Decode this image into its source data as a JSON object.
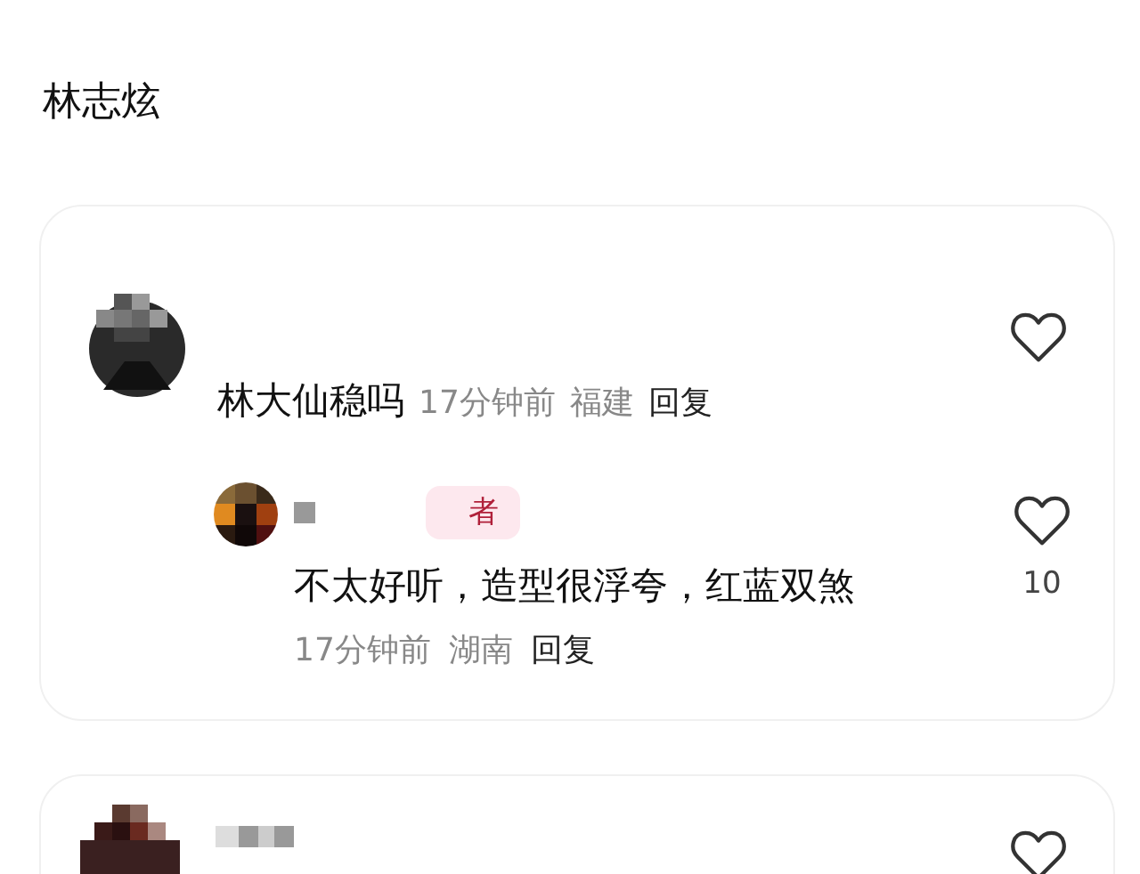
{
  "title": "林志炫",
  "comments": [
    {
      "kind": "full",
      "text": "林大仙稳吗",
      "time": "17分钟前",
      "location": "福建",
      "reply": "回复",
      "replies": [
        {
          "badge": "者",
          "text": "不太好听，造型很浮夸，红蓝双煞",
          "time": "17分钟前",
          "location": "湖南",
          "reply": "回复",
          "like_count": "10"
        }
      ]
    },
    {
      "kind": "cut"
    }
  ]
}
